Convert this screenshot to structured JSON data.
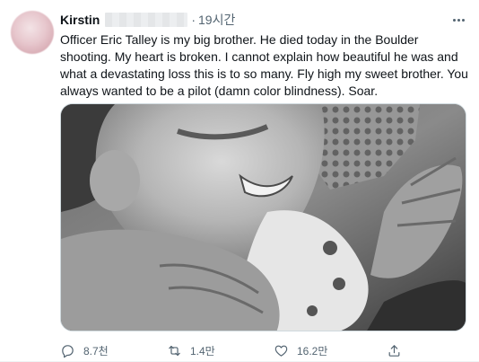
{
  "tweet": {
    "author_name": "Kirstin",
    "separator": "·",
    "time": "19시간",
    "text": "Officer Eric Talley is my big brother. He died today in the Boulder shooting. My heart is broken. I cannot explain how beautiful he was and what a devastating loss this is to so many. Fly high my sweet brother. You always wanted to be a pilot (damn color blindness). Soar."
  },
  "actions": {
    "reply_count": "8.7천",
    "retweet_count": "1.4만",
    "like_count": "16.2만"
  },
  "icons": {
    "more": "more-horizontal-icon",
    "reply": "reply-icon",
    "retweet": "retweet-icon",
    "like": "heart-icon",
    "share": "share-icon"
  },
  "colors": {
    "text_primary": "#0f1419",
    "text_secondary": "#536471",
    "border": "#cfd9de"
  }
}
